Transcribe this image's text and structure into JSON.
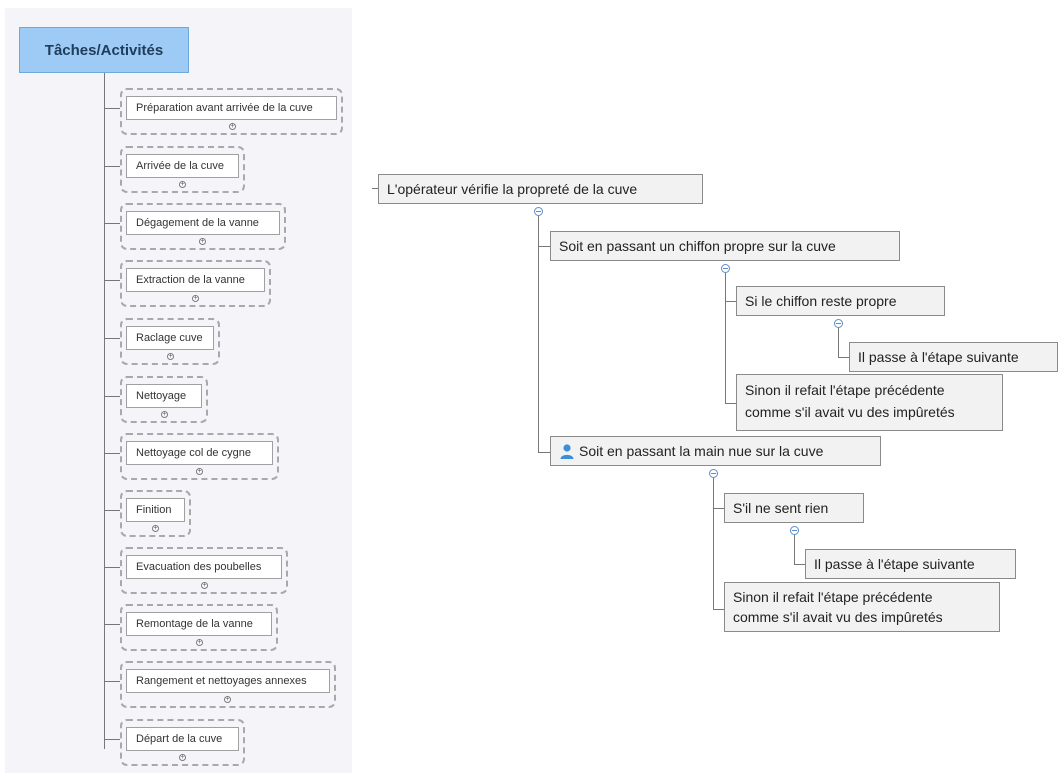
{
  "root": {
    "label": "Tâches/Activités"
  },
  "tasks": [
    "Préparation avant arrivée de la cuve",
    "Arrivée de la cuve",
    "Dégagement de la vanne",
    "Extraction de la vanne",
    "Raclage cuve",
    "Nettoyage",
    "Nettoyage col de cygne",
    "Finition",
    "Evacuation des poubelles",
    "Remontage de la vanne",
    "Rangement et nettoyages annexes",
    "Départ de la cuve"
  ],
  "detail": {
    "main": "L'opérateur vérifie la propreté de la cuve",
    "branch1": {
      "label": "Soit en passant un chiffon propre sur la cuve",
      "cond1": "Si le chiffon reste propre",
      "cond1_result": "Il passe à l'étape suivante",
      "else_line1": "Sinon il refait l'étape précédente",
      "else_line2": "comme s'il avait vu des impûretés"
    },
    "branch2": {
      "label": "Soit en passant la main nue sur la cuve",
      "icon": "user-icon",
      "cond1": "S'il ne sent rien",
      "cond1_result": "Il passe à l'étape suivante",
      "else_line1": "Sinon il refait l'étape précédente",
      "else_line2": "comme s'il avait vu des impûretés"
    }
  }
}
